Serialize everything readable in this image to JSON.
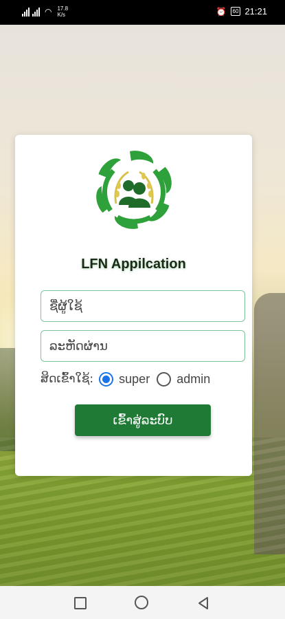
{
  "status_bar": {
    "speed_value": "17.8",
    "speed_unit": "K/s",
    "battery": "60",
    "time": "21:21"
  },
  "login_card": {
    "app_title": "LFN Appilcation",
    "username_placeholder": "ຊື່ຜູ້ໃຊ້",
    "password_placeholder": "ລະຫັດຜ່ານ",
    "user_type_label": "ສິດເຂົ້າໃຊ້:",
    "user_type_options": [
      "super",
      "admin"
    ],
    "selected_user_type": "super",
    "login_button": "ເຂົ້າສູ່ລະບົບ"
  },
  "colors": {
    "primary_green": "#1e7a34",
    "radio_selected": "#1a73e8",
    "input_border": "#7cc39a"
  },
  "icons": {
    "logo": "lfn-logo",
    "nav": [
      "square-icon",
      "circle-icon",
      "back-triangle-icon"
    ]
  }
}
